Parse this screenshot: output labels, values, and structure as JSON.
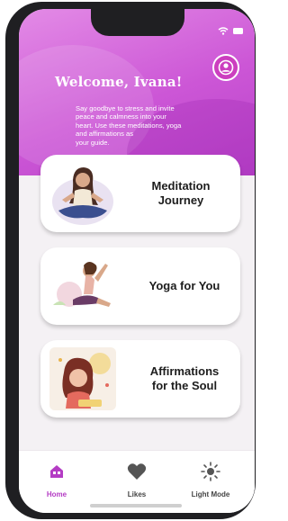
{
  "header": {
    "welcome": "Welcome, Ivana!",
    "subtitle_lines": [
      "Say goodbye to stress and invite",
      "peace and calmness into your",
      "heart. Use these meditations, yoga",
      "and affirmations as",
      "your guide."
    ],
    "profile_icon": "user-circle-icon"
  },
  "cards": [
    {
      "line1": "Meditation",
      "line2": "Journey",
      "art": "meditation-woman-illustration"
    },
    {
      "line1": "Yoga for You",
      "line2": "",
      "art": "yoga-pose-illustration"
    },
    {
      "line1": "Affirmations",
      "line2": "for the Soul",
      "art": "affirmation-woman-illustration"
    }
  ],
  "tabbar": {
    "home": {
      "label": "Home",
      "icon": "home-icon",
      "active": true
    },
    "likes": {
      "label": "Likes",
      "icon": "heart-icon"
    },
    "light_mode": {
      "label": "Light Mode",
      "icon": "sun-icon"
    }
  },
  "colors": {
    "accent": "#cc56d6",
    "active_tab": "#b43cc4",
    "inactive_tab": "#555555"
  }
}
